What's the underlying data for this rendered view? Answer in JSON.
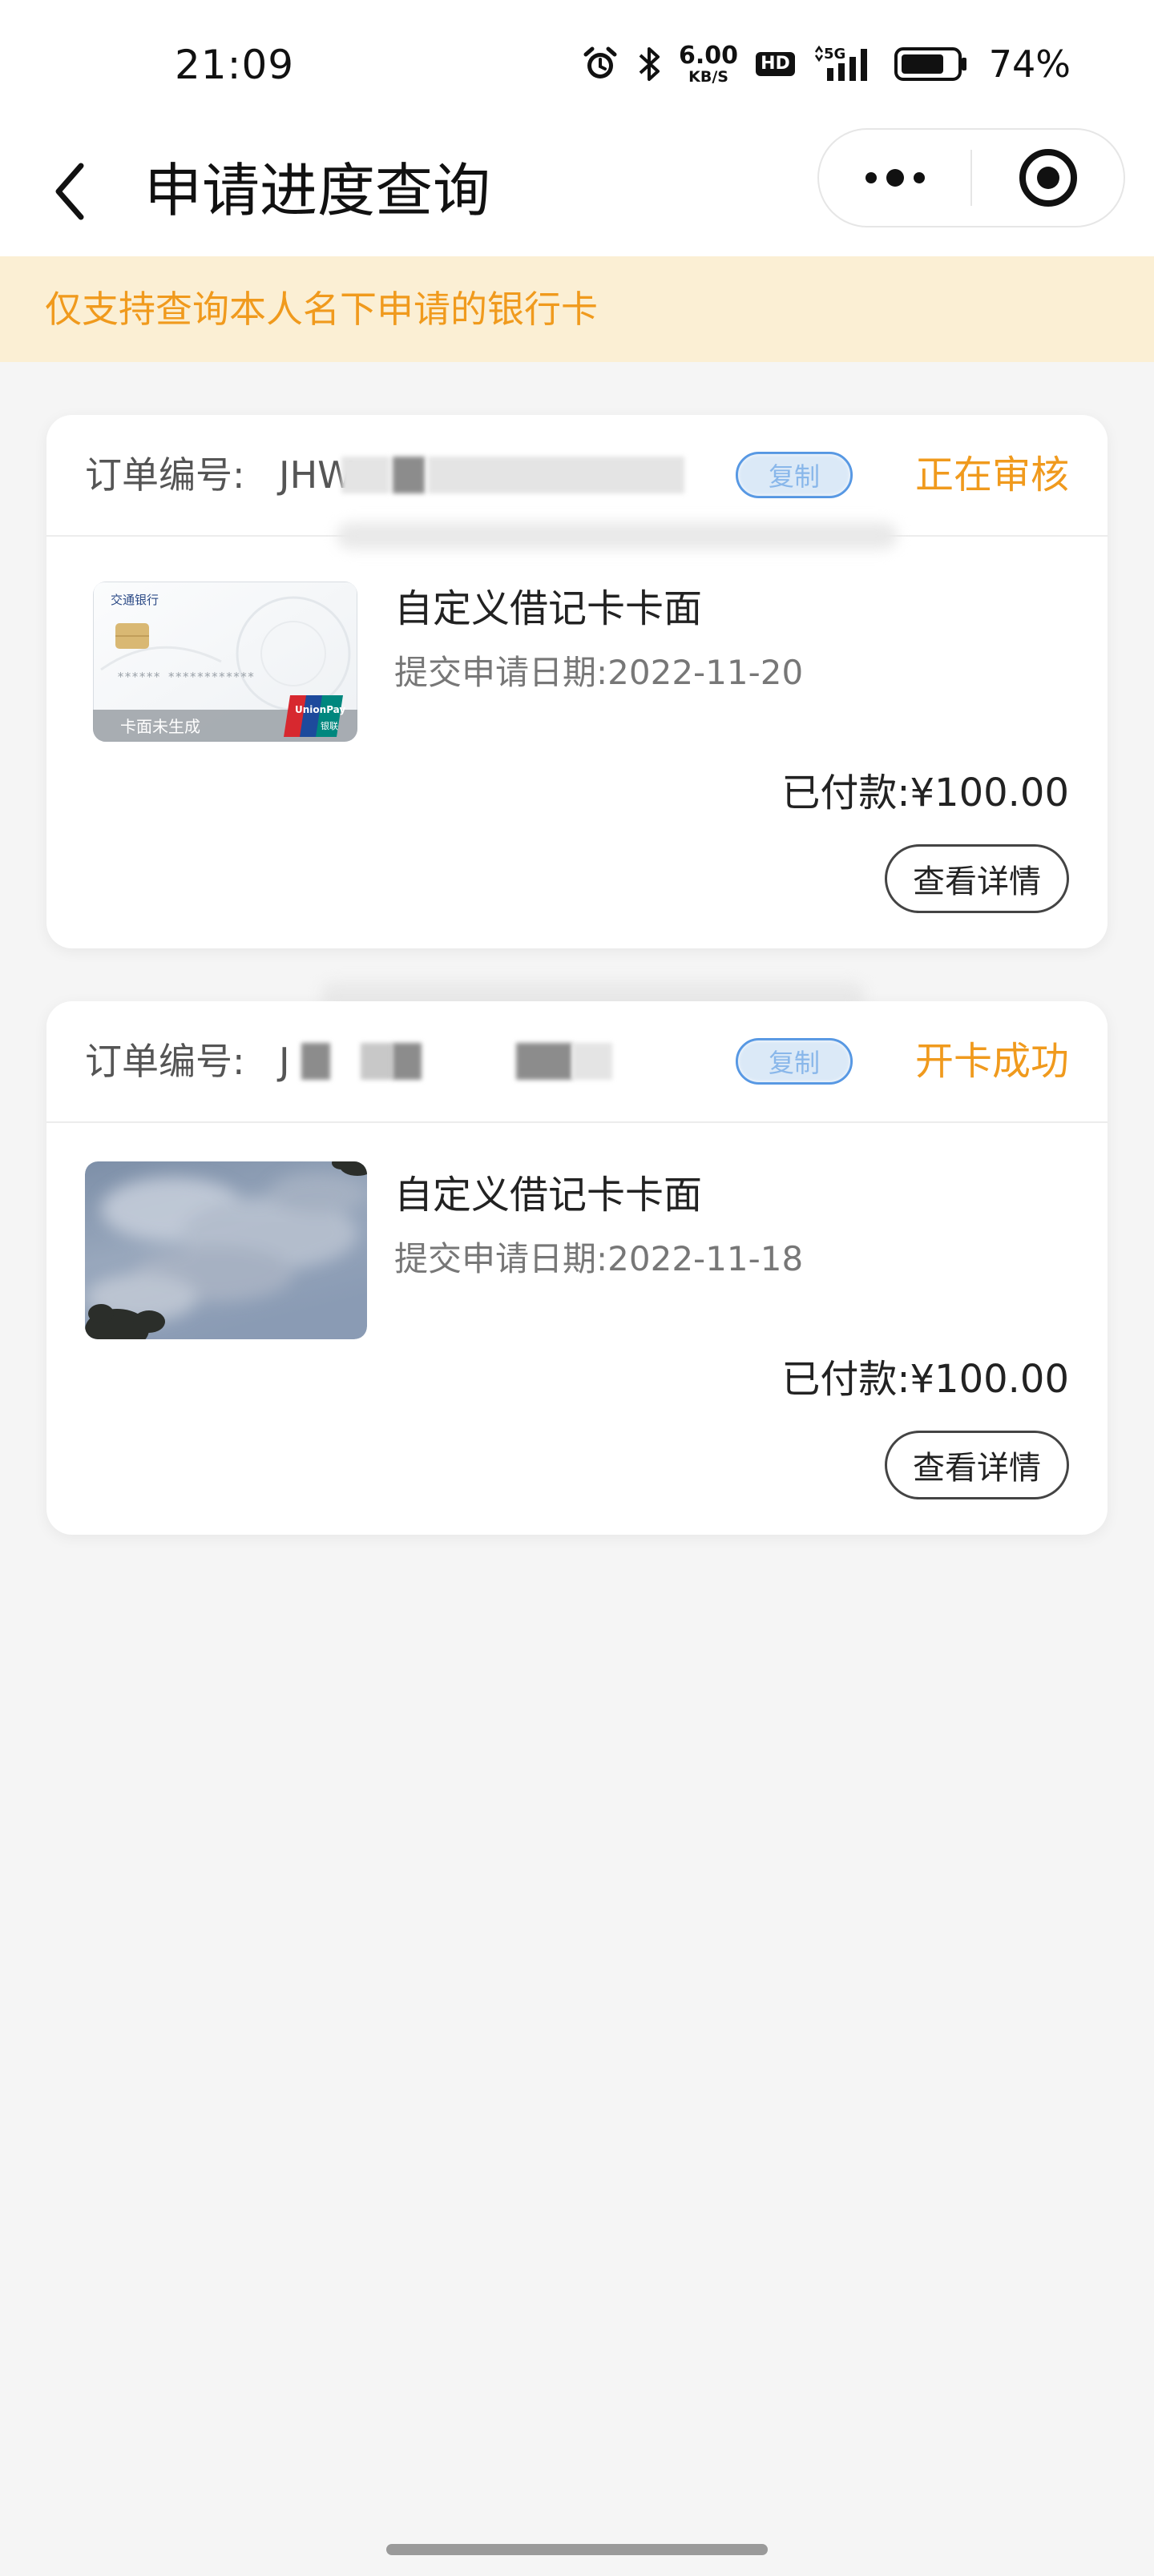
{
  "status_bar": {
    "time": "21:09",
    "speed_value": "6.00",
    "speed_unit": "KB/S",
    "hd_label": "HD",
    "network_label": "5G",
    "battery_percent": "74%",
    "icons": [
      "alarm-icon",
      "bluetooth-icon",
      "signal-icon",
      "battery-icon"
    ]
  },
  "nav": {
    "title": "申请进度查询",
    "icons": [
      "back-arrow-icon",
      "more-dots-icon",
      "target-circle-icon"
    ]
  },
  "notice": {
    "text": "仅支持查询本人名下申请的银行卡",
    "color": "#f09a1d"
  },
  "orders": [
    {
      "order_label": "订单编号:",
      "order_number_visible": "JHW",
      "copy_label": "复制",
      "status": "正在审核",
      "card_image": {
        "bank_name": "交通银行",
        "card_number_masked": "****** ************",
        "face_caption": "卡面未生成",
        "network": "UnionPay",
        "network_sub": "银联"
      },
      "title": "自定义借记卡卡面",
      "submit_date": "提交申请日期:2022-11-20",
      "paid": "已付款:¥100.00",
      "detail_label": "查看详情"
    },
    {
      "order_label": "订单编号:",
      "order_number_visible": "J",
      "copy_label": "复制",
      "status": "开卡成功",
      "card_image": {
        "description": "cloudy-sky-photo"
      },
      "title": "自定义借记卡卡面",
      "submit_date": "提交申请日期:2022-11-18",
      "paid": "已付款:¥100.00",
      "detail_label": "查看详情"
    }
  ],
  "colors": {
    "accent_orange": "#f09a1d",
    "notice_bg": "#fbefd4",
    "copy_blue": "#4a90e2",
    "page_bg": "#f5f5f5"
  }
}
